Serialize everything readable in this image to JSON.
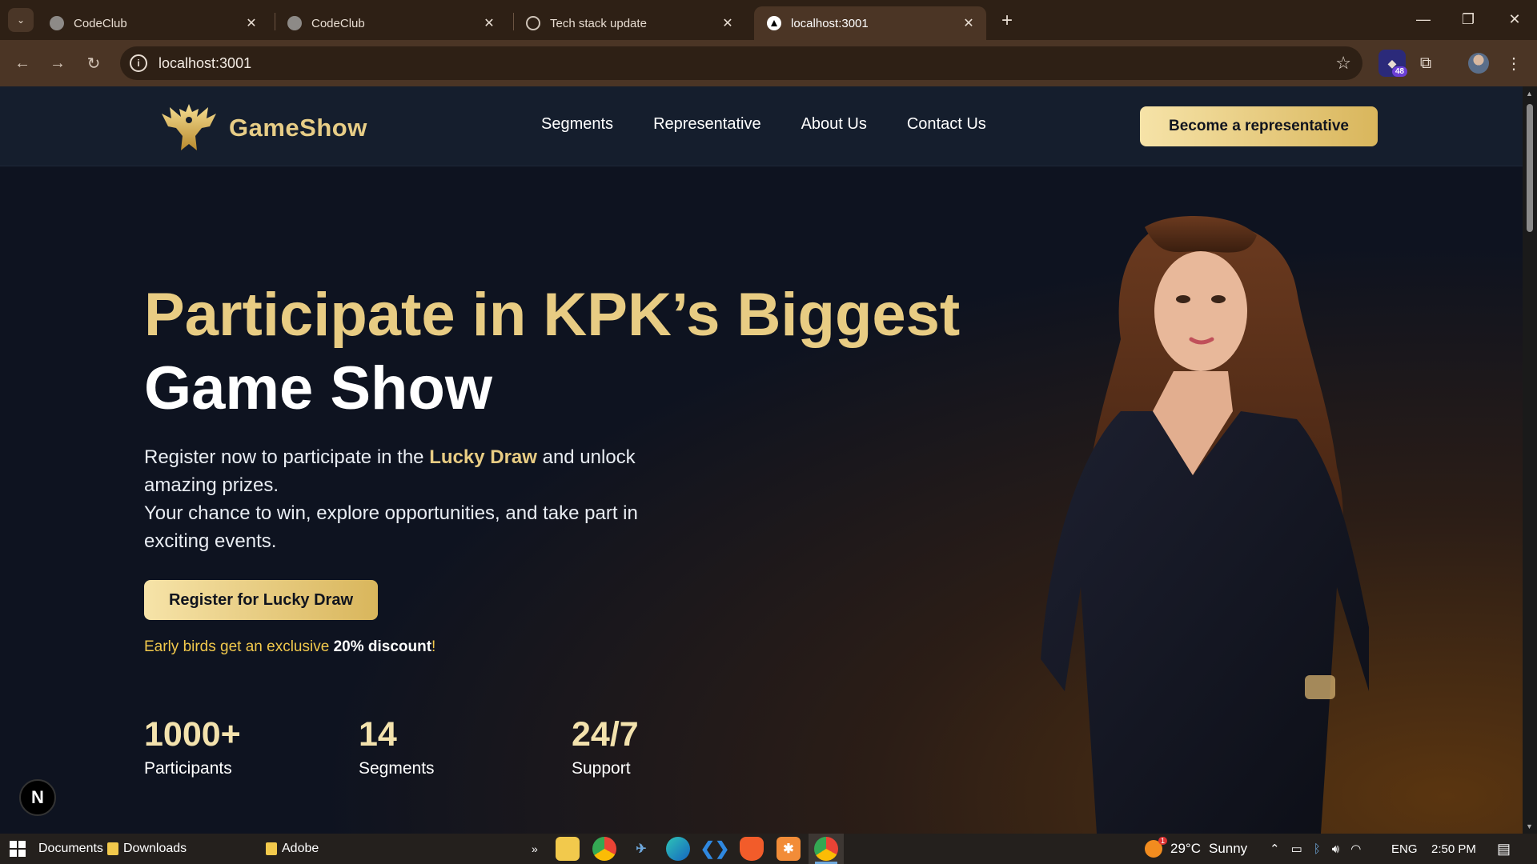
{
  "browser": {
    "tabs": [
      {
        "title": "CodeClub",
        "active": false
      },
      {
        "title": "CodeClub",
        "active": false
      },
      {
        "title": "Tech stack update",
        "active": false
      },
      {
        "title": "localhost:3001",
        "active": true
      }
    ],
    "url": "localhost:3001",
    "extension_badge": "48"
  },
  "site": {
    "brand": "GameShow",
    "nav": [
      "Segments",
      "Representative",
      "About Us",
      "Contact Us"
    ],
    "cta_top": "Become a representative",
    "headline_gold": "Participate in KPK’s Biggest",
    "headline_white": "Game Show",
    "sub_part1": "Register now to participate in the ",
    "sub_highlight": "Lucky Draw",
    "sub_part2": " and unlock amazing prizes.",
    "sub_line2": "Your chance to win, explore opportunities, and take part in exciting events.",
    "cta_main": "Register for Lucky Draw",
    "early_part1": "Early birds get an exclusive ",
    "early_bold": "20% discount",
    "early_part2": "!",
    "stats": [
      {
        "num": "1000+",
        "label": "Participants"
      },
      {
        "num": "14",
        "label": "Segments"
      },
      {
        "num": "24/7",
        "label": "Support"
      }
    ],
    "next_badge": "N"
  },
  "taskbar": {
    "pinned": [
      "Documents",
      "Downloads",
      "Adobe"
    ],
    "weather_temp": "29°C",
    "weather_text": "Sunny",
    "weather_badge": "1",
    "lang": "ENG",
    "time": "2:50 PM",
    "overflow": "»"
  },
  "colors": {
    "gold": "#e8cc83",
    "button_gradient_start": "#f6e3a8",
    "button_gradient_end": "#d9b65c",
    "page_bg": "#0e1320",
    "nav_bg": "#151e2d",
    "chrome_bg": "#2e2015"
  }
}
